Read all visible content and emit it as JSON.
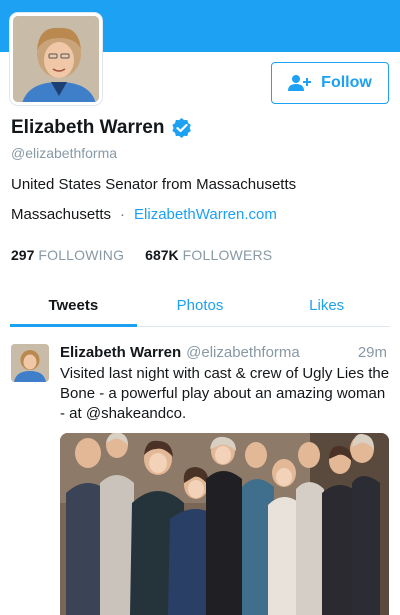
{
  "profile": {
    "name": "Elizabeth Warren",
    "handle": "@elizabethforma",
    "bio": "United States Senator from Massachusetts",
    "location": "Massachusetts",
    "separator": "·",
    "website": "ElizabethWarren.com",
    "verified_icon": "verified-badge-icon",
    "avatar_icon": "profile-photo"
  },
  "follow_button": {
    "label": "Follow",
    "icon": "add-person-icon"
  },
  "stats": {
    "following_count": "297",
    "following_label": "FOLLOWING",
    "followers_count": "687K",
    "followers_label": "FOLLOWERS"
  },
  "tabs": [
    {
      "label": "Tweets",
      "active": true
    },
    {
      "label": "Photos",
      "active": false
    },
    {
      "label": "Likes",
      "active": false
    }
  ],
  "tweet": {
    "author": "Elizabeth Warren",
    "handle": "@elizabethforma",
    "time": "29m",
    "text": "Visited last night with cast & crew of Ugly Lies the Bone - a powerful play about an amazing woman - at @shakeandco.",
    "media_icon": "group-photo"
  },
  "colors": {
    "accent": "#1da1f2",
    "text": "#14171a",
    "muted": "#8899a6",
    "divider": "#e1e8ed"
  }
}
